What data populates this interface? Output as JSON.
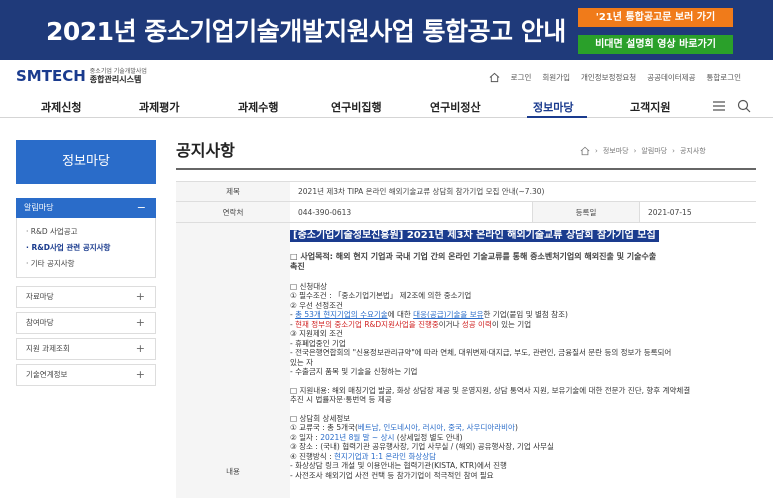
{
  "banner": {
    "title": "2021년 중소기업기술개발지원사업 통합공고 안내",
    "btn_orange": "'21년 통합공고문 보러 가기",
    "btn_green": "비대면 설명회 영상 바로가기"
  },
  "logo": {
    "main": "SMTECH",
    "sub1": "중소기업 기술개발사업",
    "sub2": "종합관리시스템"
  },
  "util": [
    "로그인",
    "회원가입",
    "개인정보정정요청",
    "공공데이터제공",
    "통합로그인"
  ],
  "gnb": [
    "과제신청",
    "과제평가",
    "과제수행",
    "연구비집행",
    "연구비정산",
    "정보마당",
    "고객지원"
  ],
  "sidebar": {
    "title": "정보마당",
    "open_label": "알림마당",
    "sub": [
      "· R&D 사업공고",
      "· R&D사업 관련 공지사항",
      "· 기타 공지사항"
    ],
    "items": [
      "자료마당",
      "참여마당",
      "지원 과제조회",
      "기술연계정보"
    ]
  },
  "page_title": "공지사항",
  "breadcrumb": [
    "정보마당",
    "알림마당",
    "공지사항"
  ],
  "table": {
    "subject_label": "제목",
    "subject": "2021년 제3차 TIPA 온라인 해외기술교류 상담회 참가기업 모집 안내(~7.30)",
    "contact_label": "연락처",
    "contact": "044-390-0613",
    "date_label": "등록일",
    "date": "2021-07-15",
    "content_label": "내용"
  },
  "content": {
    "headline": "[중소기업기술정보진흥원] 2021년 제3차 온라인 해외기술교류 상담회 참가기업 모집",
    "purpose_1": "□ 사업목적: 해외 현지 기업과 국내 기업 간의 온라인 기술교류를 통해 중소벤처기업의 해외진출 및 기술수출",
    "purpose_2": "촉진",
    "target_h": "□ 신청대상",
    "t1": "① 필수조건 : 「중소기업기본법」 제2조에 의한 중소기업",
    "t2": "② 우선 선정조건",
    "t3a": " - ",
    "t3b": "총 53개 현지기업의 수요기술",
    "t3c": "에 대한 ",
    "t3d": "대응(공급)기술을 보유",
    "t3e": "한 기업(붙임 및 별첨 참조)",
    "t4a": " - ",
    "t4b": "현재 정부의 중소기업 R&D지원사업을 진행중",
    "t4c": "이거나 ",
    "t4d": "성공 이력",
    "t4e": "이 있는 기업",
    "t5": "③ 지원제외 조건",
    "t6": " - 휴폐업중인 기업",
    "t7": " - 전국은행연합회의 \"신용정보관리규약\"에 따라 연체, 대위변제·대지급, 부도, 관련인, 금융질서 문란 등의 정보가 등록되어",
    "t8": "있는 자",
    "t9": " - 수출금지 품목 및 기술을 신청하는 기업",
    "support_1": "□ 지원내용: 해외 매칭기업 발굴, 화상 상담장 제공 및 운영지원, 상담 통역사 지원, 보유기술에 대한 전문가 진단, 향후 계약체결",
    "support_2": "추진 시 법률자문·통번역 등 제공",
    "detail_h": "□ 상담회 상세정보",
    "d1a": "① 교류국 : 총 5개국(",
    "d1b": "베트남, 인도네시아, 러시아, 중국, 사우디아라비아",
    "d1c": ")",
    "d2a": "② 일자 : ",
    "d2b": "2021년 8월 말 ~ 상시",
    "d2c": " (상세일정 별도 안내)",
    "d3": "③ 장소 : (국내) 협력기관 공유행사장, 기업 사무실 / (해외) 공유행사장, 기업 사무실",
    "d4a": "④ 진행방식 : ",
    "d4b": "현지기업과 1:1 온라인 화상상담",
    "d5": " - 화상상담 링크 개설 및 이용안내는 협력기관(KISTA, KTR)에서 진행",
    "d6": " - 사전조사 해외기업 사전 컨택 등 참가기업이 적극적인 참여 필요"
  }
}
